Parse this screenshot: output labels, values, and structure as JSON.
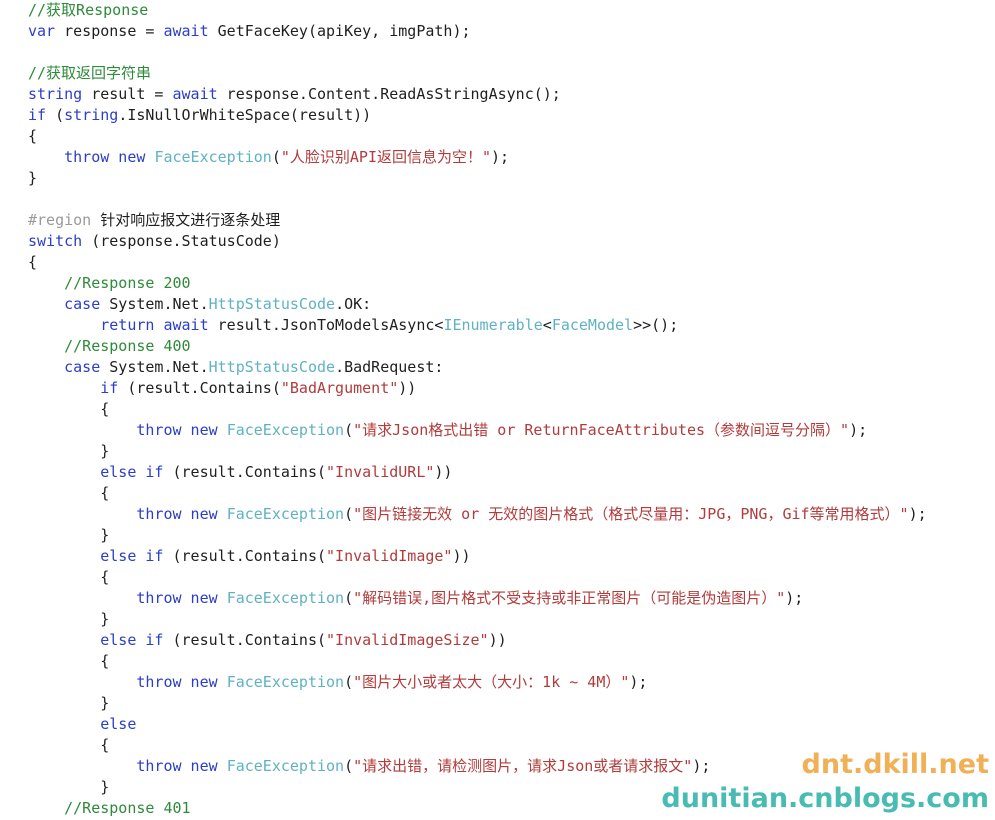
{
  "document": {
    "kind": "source-code-screenshot",
    "language": "C#",
    "font_size_px": 15,
    "line_height_px": 21,
    "background": "#ffffff",
    "colors": {
      "plain": "#1f1f1f",
      "keyword": "#2b3ec9",
      "comment": "#2e8b39",
      "string": "#b23b3b",
      "type": "#5fb2c4",
      "preprocessor": "#9a9a9a",
      "watermark_orange": "#f0ad4e",
      "watermark_teal": "#3fb8ae"
    }
  },
  "code": {
    "lines": [
      {
        "indent": 0,
        "tokens": [
          {
            "c": "comment",
            "t": "//获取Response"
          }
        ]
      },
      {
        "indent": 0,
        "tokens": [
          {
            "c": "keyword",
            "t": "var"
          },
          {
            "c": "plain",
            "t": " response = "
          },
          {
            "c": "keyword",
            "t": "await"
          },
          {
            "c": "plain",
            "t": " GetFaceKey(apiKey, imgPath);"
          }
        ]
      },
      {
        "indent": 0,
        "tokens": []
      },
      {
        "indent": 0,
        "tokens": [
          {
            "c": "comment",
            "t": "//获取返回字符串"
          }
        ]
      },
      {
        "indent": 0,
        "tokens": [
          {
            "c": "keyword",
            "t": "string"
          },
          {
            "c": "plain",
            "t": " result = "
          },
          {
            "c": "keyword",
            "t": "await"
          },
          {
            "c": "plain",
            "t": " response.Content.ReadAsStringAsync();"
          }
        ]
      },
      {
        "indent": 0,
        "tokens": [
          {
            "c": "keyword",
            "t": "if"
          },
          {
            "c": "plain",
            "t": " ("
          },
          {
            "c": "keyword",
            "t": "string"
          },
          {
            "c": "plain",
            "t": ".IsNullOrWhiteSpace(result))"
          }
        ]
      },
      {
        "indent": 0,
        "tokens": [
          {
            "c": "plain",
            "t": "{"
          }
        ]
      },
      {
        "indent": 1,
        "tokens": [
          {
            "c": "keyword",
            "t": "throw new"
          },
          {
            "c": "plain",
            "t": " "
          },
          {
            "c": "type",
            "t": "FaceException"
          },
          {
            "c": "plain",
            "t": "("
          },
          {
            "c": "string",
            "t": "\"人脸识别API返回信息为空！\""
          },
          {
            "c": "plain",
            "t": ");"
          }
        ]
      },
      {
        "indent": 0,
        "tokens": [
          {
            "c": "plain",
            "t": "}"
          }
        ]
      },
      {
        "indent": 0,
        "tokens": []
      },
      {
        "indent": 0,
        "tokens": [
          {
            "c": "preproc",
            "t": "#region"
          },
          {
            "c": "plain",
            "t": " 针对响应报文进行逐条处理"
          }
        ]
      },
      {
        "indent": 0,
        "tokens": [
          {
            "c": "keyword",
            "t": "switch"
          },
          {
            "c": "plain",
            "t": " (response.StatusCode)"
          }
        ]
      },
      {
        "indent": 0,
        "tokens": [
          {
            "c": "plain",
            "t": "{"
          }
        ]
      },
      {
        "indent": 1,
        "tokens": [
          {
            "c": "comment",
            "t": "//Response 200"
          }
        ]
      },
      {
        "indent": 1,
        "tokens": [
          {
            "c": "keyword",
            "t": "case"
          },
          {
            "c": "plain",
            "t": " System.Net."
          },
          {
            "c": "type",
            "t": "HttpStatusCode"
          },
          {
            "c": "plain",
            "t": ".OK:"
          }
        ]
      },
      {
        "indent": 2,
        "tokens": [
          {
            "c": "keyword",
            "t": "return await"
          },
          {
            "c": "plain",
            "t": " result.JsonToModelsAsync<"
          },
          {
            "c": "type",
            "t": "IEnumerable"
          },
          {
            "c": "plain",
            "t": "<"
          },
          {
            "c": "type",
            "t": "FaceModel"
          },
          {
            "c": "plain",
            "t": ">>();"
          }
        ]
      },
      {
        "indent": 1,
        "tokens": [
          {
            "c": "comment",
            "t": "//Response 400"
          }
        ]
      },
      {
        "indent": 1,
        "tokens": [
          {
            "c": "keyword",
            "t": "case"
          },
          {
            "c": "plain",
            "t": " System.Net."
          },
          {
            "c": "type",
            "t": "HttpStatusCode"
          },
          {
            "c": "plain",
            "t": ".BadRequest:"
          }
        ]
      },
      {
        "indent": 2,
        "tokens": [
          {
            "c": "keyword",
            "t": "if"
          },
          {
            "c": "plain",
            "t": " (result.Contains("
          },
          {
            "c": "string",
            "t": "\"BadArgument\""
          },
          {
            "c": "plain",
            "t": "))"
          }
        ]
      },
      {
        "indent": 2,
        "tokens": [
          {
            "c": "plain",
            "t": "{"
          }
        ]
      },
      {
        "indent": 3,
        "tokens": [
          {
            "c": "keyword",
            "t": "throw new"
          },
          {
            "c": "plain",
            "t": " "
          },
          {
            "c": "type",
            "t": "FaceException"
          },
          {
            "c": "plain",
            "t": "("
          },
          {
            "c": "string",
            "t": "\"请求Json格式出错 or ReturnFaceAttributes（参数间逗号分隔）\""
          },
          {
            "c": "plain",
            "t": ");"
          }
        ]
      },
      {
        "indent": 2,
        "tokens": [
          {
            "c": "plain",
            "t": "}"
          }
        ]
      },
      {
        "indent": 2,
        "tokens": [
          {
            "c": "keyword",
            "t": "else if"
          },
          {
            "c": "plain",
            "t": " (result.Contains("
          },
          {
            "c": "string",
            "t": "\"InvalidURL\""
          },
          {
            "c": "plain",
            "t": "))"
          }
        ]
      },
      {
        "indent": 2,
        "tokens": [
          {
            "c": "plain",
            "t": "{"
          }
        ]
      },
      {
        "indent": 3,
        "tokens": [
          {
            "c": "keyword",
            "t": "throw new"
          },
          {
            "c": "plain",
            "t": " "
          },
          {
            "c": "type",
            "t": "FaceException"
          },
          {
            "c": "plain",
            "t": "("
          },
          {
            "c": "string",
            "t": "\"图片链接无效 or 无效的图片格式（格式尽量用：JPG，PNG，Gif等常用格式）\""
          },
          {
            "c": "plain",
            "t": ");"
          }
        ]
      },
      {
        "indent": 2,
        "tokens": [
          {
            "c": "plain",
            "t": "}"
          }
        ]
      },
      {
        "indent": 2,
        "tokens": [
          {
            "c": "keyword",
            "t": "else if"
          },
          {
            "c": "plain",
            "t": " (result.Contains("
          },
          {
            "c": "string",
            "t": "\"InvalidImage\""
          },
          {
            "c": "plain",
            "t": "))"
          }
        ]
      },
      {
        "indent": 2,
        "tokens": [
          {
            "c": "plain",
            "t": "{"
          }
        ]
      },
      {
        "indent": 3,
        "tokens": [
          {
            "c": "keyword",
            "t": "throw new"
          },
          {
            "c": "plain",
            "t": " "
          },
          {
            "c": "type",
            "t": "FaceException"
          },
          {
            "c": "plain",
            "t": "("
          },
          {
            "c": "string",
            "t": "\"解码错误,图片格式不受支持或非正常图片（可能是伪造图片）\""
          },
          {
            "c": "plain",
            "t": ");"
          }
        ]
      },
      {
        "indent": 2,
        "tokens": [
          {
            "c": "plain",
            "t": "}"
          }
        ]
      },
      {
        "indent": 2,
        "tokens": [
          {
            "c": "keyword",
            "t": "else if"
          },
          {
            "c": "plain",
            "t": " (result.Contains("
          },
          {
            "c": "string",
            "t": "\"InvalidImageSize\""
          },
          {
            "c": "plain",
            "t": "))"
          }
        ]
      },
      {
        "indent": 2,
        "tokens": [
          {
            "c": "plain",
            "t": "{"
          }
        ]
      },
      {
        "indent": 3,
        "tokens": [
          {
            "c": "keyword",
            "t": "throw new"
          },
          {
            "c": "plain",
            "t": " "
          },
          {
            "c": "type",
            "t": "FaceException"
          },
          {
            "c": "plain",
            "t": "("
          },
          {
            "c": "string",
            "t": "\"图片大小或者太大（大小：1k ~ 4M）\""
          },
          {
            "c": "plain",
            "t": ");"
          }
        ]
      },
      {
        "indent": 2,
        "tokens": [
          {
            "c": "plain",
            "t": "}"
          }
        ]
      },
      {
        "indent": 2,
        "tokens": [
          {
            "c": "keyword",
            "t": "else"
          }
        ]
      },
      {
        "indent": 2,
        "tokens": [
          {
            "c": "plain",
            "t": "{"
          }
        ]
      },
      {
        "indent": 3,
        "tokens": [
          {
            "c": "keyword",
            "t": "throw new"
          },
          {
            "c": "plain",
            "t": " "
          },
          {
            "c": "type",
            "t": "FaceException"
          },
          {
            "c": "plain",
            "t": "("
          },
          {
            "c": "string",
            "t": "\"请求出错，请检测图片，请求Json或者请求报文\""
          },
          {
            "c": "plain",
            "t": ");"
          }
        ]
      },
      {
        "indent": 2,
        "tokens": [
          {
            "c": "plain",
            "t": "}"
          }
        ]
      },
      {
        "indent": 1,
        "tokens": [
          {
            "c": "comment",
            "t": "//Response 401"
          }
        ]
      }
    ]
  },
  "watermark": {
    "line1": "dnt.dkill.net",
    "line2": "dunitian.cnblogs.com"
  }
}
